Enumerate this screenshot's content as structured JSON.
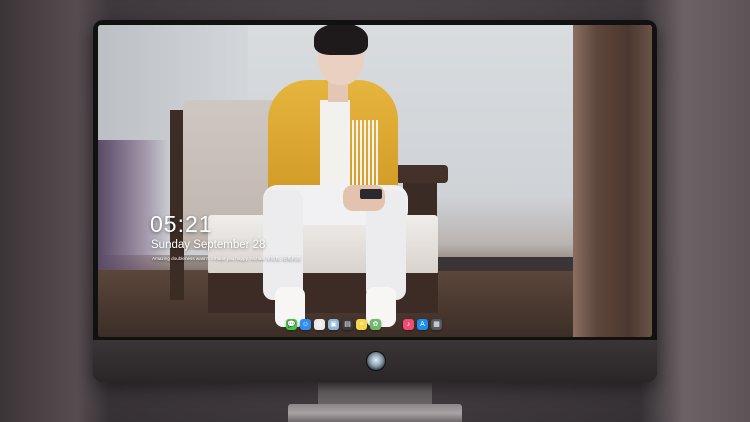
{
  "lockscreen": {
    "time": "05:21",
    "date": "Sunday September  28",
    "quote": "Amazing doubleness wasn't, I made you happy. Aichasi 深情我, 陪我到底"
  },
  "dock": {
    "icons": [
      {
        "name": "messages-icon",
        "color": "#3ec94a",
        "glyph": "💬"
      },
      {
        "name": "finder-icon",
        "color": "#2f8ff0",
        "glyph": "☺"
      },
      {
        "name": "safari-icon",
        "color": "#e9e9ea",
        "glyph": "◎"
      },
      {
        "name": "preview-icon",
        "color": "#8fb6d8",
        "glyph": "▣"
      },
      {
        "name": "clapper-icon",
        "color": "#3a3a3a",
        "glyph": "▤"
      },
      {
        "name": "notes-icon",
        "color": "#f7d64a",
        "glyph": "≡"
      },
      {
        "name": "photos-icon",
        "color": "#6fb86a",
        "glyph": "✿"
      },
      {
        "name": "music-icon",
        "color": "#f04a78",
        "glyph": "♪"
      },
      {
        "name": "app-store-icon",
        "color": "#1d8df2",
        "glyph": "A"
      },
      {
        "name": "briefcase-icon",
        "color": "#555a60",
        "glyph": "▦"
      }
    ]
  },
  "colors": {
    "accent_white": "#ffffff",
    "monitor_frame": "#111111"
  }
}
